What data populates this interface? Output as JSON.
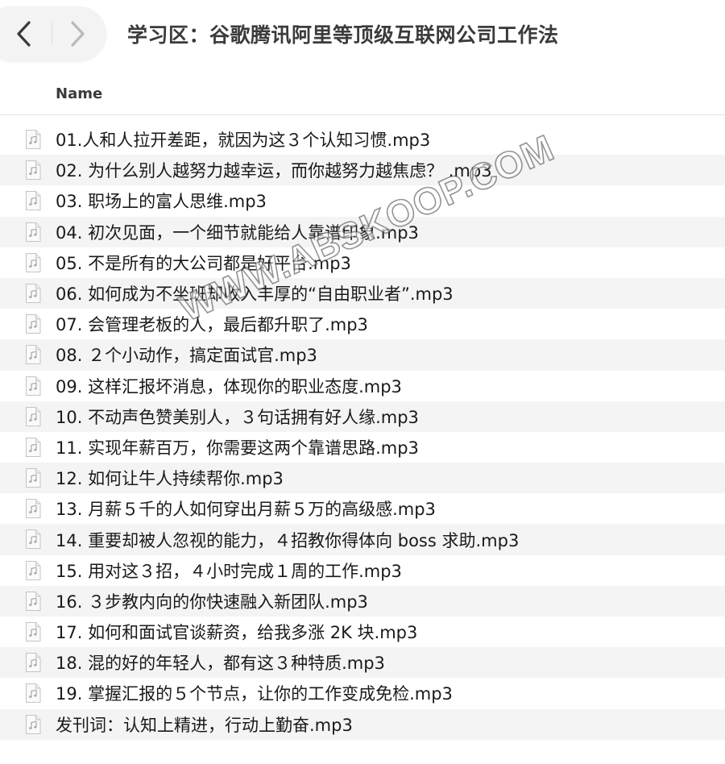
{
  "toolbar": {
    "back_icon": "chevron-left-icon",
    "forward_icon": "chevron-right-icon",
    "title": "学习区：谷歌腾讯阿里等顶级互联网公司工作法"
  },
  "columns": {
    "name": "Name"
  },
  "files": [
    {
      "name": "01.人和人拉开差距，就因为这３个认知习惯.mp3",
      "icon": "audio-file-icon"
    },
    {
      "name": "02. 为什么别人越努力越幸运，而你越努力越焦虑？ .mp3",
      "icon": "audio-file-icon"
    },
    {
      "name": "03. 职场上的富人思维.mp3",
      "icon": "audio-file-icon"
    },
    {
      "name": "04. 初次见面，一个细节就能给人靠谱印象.mp3",
      "icon": "audio-file-icon"
    },
    {
      "name": "05. 不是所有的大公司都是好平台.mp3",
      "icon": "audio-file-icon"
    },
    {
      "name": "06. 如何成为不坐班却收入丰厚的“自由职业者”.mp3",
      "icon": "audio-file-icon"
    },
    {
      "name": "07. 会管理老板的人，最后都升职了.mp3",
      "icon": "audio-file-icon"
    },
    {
      "name": "08. ２个小动作，搞定面试官.mp3",
      "icon": "audio-file-icon"
    },
    {
      "name": "09. 这样汇报坏消息，体现你的职业态度.mp3",
      "icon": "audio-file-icon"
    },
    {
      "name": "10. 不动声色赞美别人，３句话拥有好人缘.mp3",
      "icon": "audio-file-icon"
    },
    {
      "name": "11. 实现年薪百万，你需要这两个靠谱思路.mp3",
      "icon": "audio-file-icon"
    },
    {
      "name": "12. 如何让牛人持续帮你.mp3",
      "icon": "audio-file-icon"
    },
    {
      "name": "13. 月薪５千的人如何穿出月薪５万的高级感.mp3",
      "icon": "audio-file-icon"
    },
    {
      "name": "14. 重要却被人忽视的能力，４招教你得体向 boss 求助.mp3",
      "icon": "audio-file-icon"
    },
    {
      "name": "15. 用对这３招，４小时完成１周的工作.mp3",
      "icon": "audio-file-icon"
    },
    {
      "name": "16. ３步教内向的你快速融入新团队.mp3",
      "icon": "audio-file-icon"
    },
    {
      "name": "17. 如何和面试官谈薪资，给我多涨 2K 块.mp3",
      "icon": "audio-file-icon"
    },
    {
      "name": "18. 混的好的年轻人，都有这３种特质.mp3",
      "icon": "audio-file-icon"
    },
    {
      "name": "19. 掌握汇报的５个节点，让你的工作变成免检.mp3",
      "icon": "audio-file-icon"
    },
    {
      "name": "发刊词：认知上精进，行动上勤奋.mp3",
      "icon": "audio-file-icon"
    }
  ],
  "watermark": {
    "text": "WWW.ABSKOOP.COM"
  }
}
